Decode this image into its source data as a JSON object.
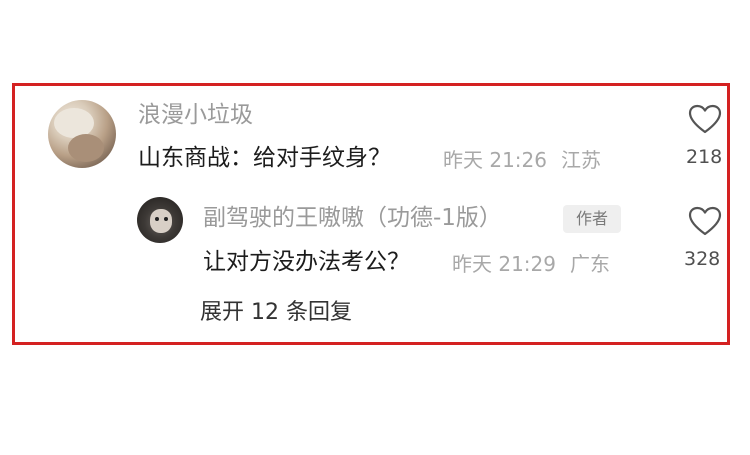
{
  "comment": {
    "username": "浪漫小垃圾",
    "text": "山东商战：给对手纹身？",
    "time": "昨天 21:26",
    "location": "江苏",
    "like_count": "218"
  },
  "reply": {
    "username": "副驾驶的王嗷嗷（功德-1版）",
    "author_badge": "作者",
    "text": "让对方没办法考公？",
    "time": "昨天 21:29",
    "location": "广东",
    "like_count": "328"
  },
  "expand_replies_label": "展开 12 条回复",
  "colors": {
    "highlight_border": "#d42121",
    "username": "#9a9a9a",
    "content": "#1c1c1c",
    "meta": "#a8a8a8"
  },
  "icons": {
    "like": "heart-outline-icon"
  }
}
